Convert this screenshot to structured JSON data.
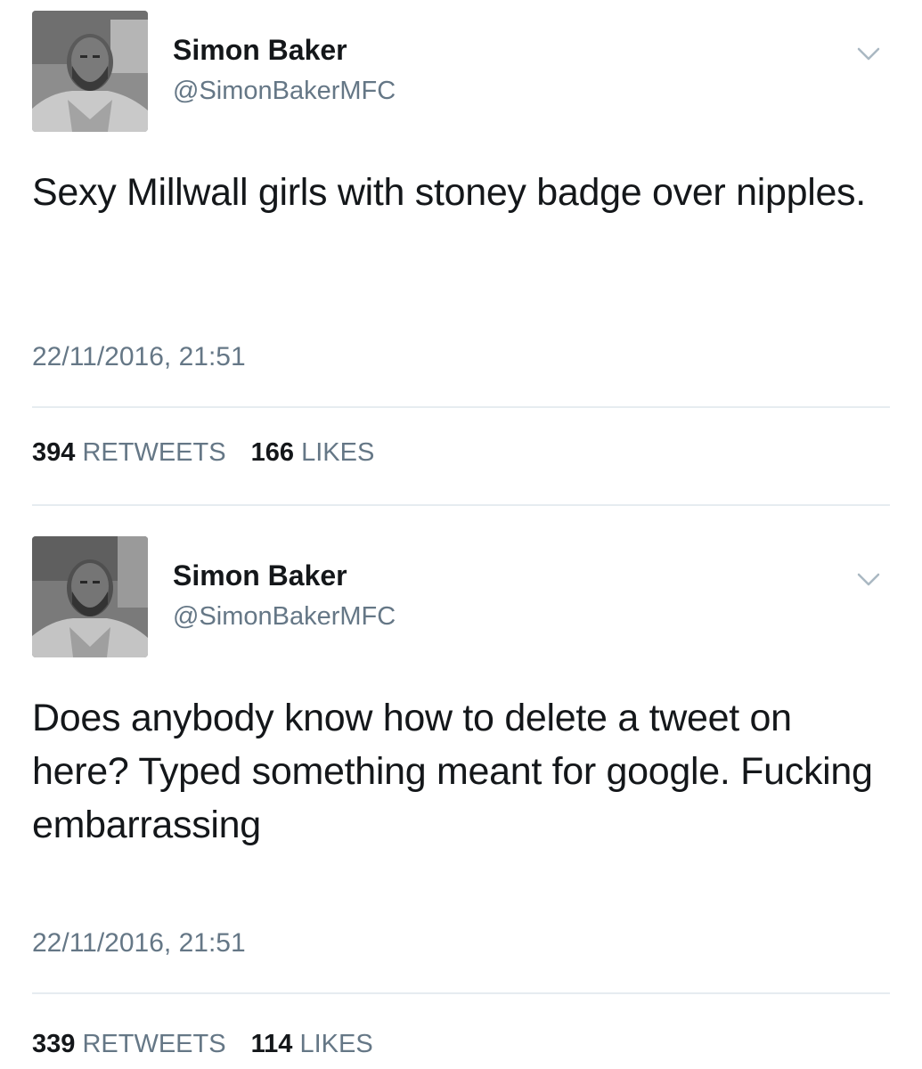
{
  "tweets": [
    {
      "name": "Simon Baker",
      "handle": "@SimonBakerMFC",
      "text": "Sexy Millwall girls with stoney badge over nipples.",
      "timestamp": "22/11/2016, 21:51",
      "retweets": "394",
      "retweets_label": "RETWEETS",
      "likes": "166",
      "likes_label": "LIKES",
      "avatar_icon": "profile-photo-icon",
      "menu_icon": "chevron-down-icon"
    },
    {
      "name": "Simon Baker",
      "handle": "@SimonBakerMFC",
      "text": "Does anybody know how to delete a tweet on here? Typed something meant for google. Fucking embarrassing",
      "timestamp": "22/11/2016, 21:51",
      "retweets": "339",
      "retweets_label": "RETWEETS",
      "likes": "114",
      "likes_label": "LIKES",
      "avatar_icon": "profile-photo-icon",
      "menu_icon": "chevron-down-icon"
    }
  ],
  "colors": {
    "text_primary": "#14171a",
    "text_secondary": "#657786",
    "divider": "#e6ecf0",
    "background": "#ffffff"
  }
}
